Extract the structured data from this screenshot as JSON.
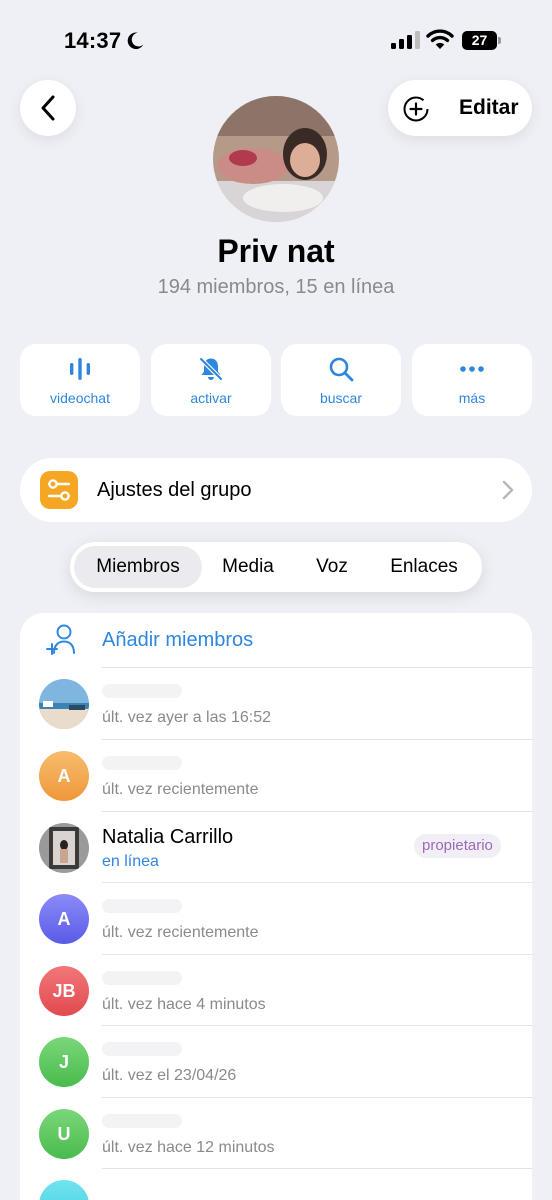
{
  "status_bar": {
    "time": "14:37",
    "battery": "27"
  },
  "header": {
    "edit_label": "Editar"
  },
  "group": {
    "name": "Priv nat",
    "subtitle": "194 miembros, 15 en línea"
  },
  "actions": [
    {
      "label": "videochat",
      "icon": "video-chat-icon"
    },
    {
      "label": "activar",
      "icon": "bell-slash-icon"
    },
    {
      "label": "buscar",
      "icon": "search-icon"
    },
    {
      "label": "más",
      "icon": "more-icon"
    }
  ],
  "settings": {
    "label": "Ajustes del grupo"
  },
  "tabs": [
    "Miembros",
    "Media",
    "Voz",
    "Enlaces"
  ],
  "add_members": {
    "label": "Añadir miembros"
  },
  "members": [
    {
      "name": "",
      "initials": "",
      "status": "últ. vez ayer a las 16:52"
    },
    {
      "name": "",
      "initials": "A",
      "status": "últ. vez recientemente"
    },
    {
      "name": "Natalia Carrillo",
      "initials": "",
      "status": "en línea",
      "badge": "propietario"
    },
    {
      "name": "",
      "initials": "A",
      "status": "últ. vez recientemente"
    },
    {
      "name": "",
      "initials": "JB",
      "status": "últ. vez hace 4 minutos"
    },
    {
      "name": "",
      "initials": "J",
      "status": "últ. vez el 23/04/26"
    },
    {
      "name": "",
      "initials": "U",
      "status": "últ. vez hace 12 minutos"
    },
    {
      "name": "",
      "initials": "",
      "status": ""
    }
  ],
  "colors": {
    "accent": "#2f86e0",
    "background": "#eff0f5",
    "settings_icon": "#f5a623",
    "owner_badge_text": "#9b6bb7",
    "avatar_orange": "#f2a14a",
    "avatar_violet": "#6b6cf0",
    "avatar_red": "#e8585a",
    "avatar_green": "#5bc85b",
    "avatar_cyan": "#4fd6e6"
  }
}
